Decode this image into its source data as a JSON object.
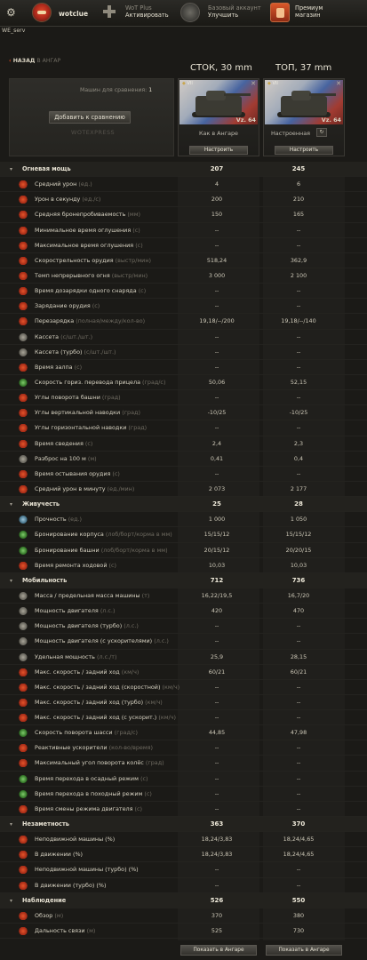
{
  "topbar": {
    "nickname": "wotclue",
    "wotplus": {
      "line1": "WoT Plus",
      "line2": "Активировать"
    },
    "account": {
      "line1": "Базовый аккаунт",
      "line2": "Улучшить"
    },
    "premium": {
      "line1": "Премиум",
      "line2": "магазин"
    },
    "server": "WE_serv"
  },
  "nav": {
    "back_label": "НАЗАД",
    "back_context": "В АНГАР"
  },
  "columns": {
    "col1_title": "СТОК, 30 mm",
    "col2_title": "ТОП, 37 mm"
  },
  "compare": {
    "count_label": "Машин для сравнения:",
    "count_value": "1",
    "add_button": "Добавить к сравнению",
    "watermark": "WOTEXPRESS"
  },
  "tanks": [
    {
      "tier": "VII",
      "name": "Vz. 64",
      "state": "Как в Ангаре",
      "configure": "Настроить",
      "flag_colors": [
        "#efe8e2",
        "#4d6fb6",
        "#b84035"
      ]
    },
    {
      "tier": "VII",
      "name": "Vz. 64",
      "state": "Настроенная",
      "configure": "Настроить",
      "flag_colors": [
        "#efe8e2",
        "#4d6fb6",
        "#b84035"
      ]
    }
  ],
  "rows": [
    {
      "type": "section",
      "name": "Огневая мощь",
      "unit": "",
      "v1": "207",
      "v2": "245"
    },
    {
      "type": "row",
      "icon": "red",
      "name": "Средний урон",
      "unit": "(ед.)",
      "v1": "4",
      "v2": "6"
    },
    {
      "type": "row",
      "icon": "red",
      "name": "Урон в секунду",
      "unit": "(ед./с)",
      "v1": "200",
      "v2": "210"
    },
    {
      "type": "row",
      "icon": "red",
      "name": "Средняя бронепробиваемость",
      "unit": "(мм)",
      "v1": "150",
      "v2": "165"
    },
    {
      "type": "row",
      "icon": "red",
      "name": "Минимальное время оглушения",
      "unit": "(с)",
      "v1": "--",
      "v2": "--"
    },
    {
      "type": "row",
      "icon": "red",
      "name": "Максимальное время оглушения",
      "unit": "(с)",
      "v1": "--",
      "v2": "--"
    },
    {
      "type": "row",
      "icon": "red",
      "name": "Скорострельность орудия",
      "unit": "(выстр/мин)",
      "v1": "518,24",
      "v2": "362,9"
    },
    {
      "type": "row",
      "icon": "red",
      "name": "Темп непрерывного огня",
      "unit": "(выстр/мин)",
      "v1": "3 000",
      "v2": "2 100"
    },
    {
      "type": "row",
      "icon": "red",
      "name": "Время дозарядки одного снаряда",
      "unit": "(с)",
      "v1": "--",
      "v2": "--"
    },
    {
      "type": "row",
      "icon": "red",
      "name": "Зарядание орудия",
      "unit": "(с)",
      "v1": "--",
      "v2": "--"
    },
    {
      "type": "row",
      "icon": "red",
      "name": "Перезарядка",
      "unit": "(полная/между/кол-во)",
      "v1": "19,18/--/200",
      "v2": "19,18/--/140"
    },
    {
      "type": "row",
      "icon": "grey",
      "name": "Кассета",
      "unit": "(с/шт./шт.)",
      "v1": "--",
      "v2": "--"
    },
    {
      "type": "row",
      "icon": "grey",
      "name": "Кассета (турбо)",
      "unit": "(с/шт./шт.)",
      "v1": "--",
      "v2": "--"
    },
    {
      "type": "row",
      "icon": "red",
      "name": "Время залпа",
      "unit": "(с)",
      "v1": "--",
      "v2": "--"
    },
    {
      "type": "row",
      "icon": "green",
      "name": "Скорость гориз. перевода прицела",
      "unit": "(град/с)",
      "v1": "50,06",
      "v2": "52,15"
    },
    {
      "type": "row",
      "icon": "red",
      "name": "Углы поворота башни",
      "unit": "(град)",
      "v1": "--",
      "v2": "--"
    },
    {
      "type": "row",
      "icon": "red",
      "name": "Углы вертикальной наводки",
      "unit": "(град)",
      "v1": "-10/25",
      "v2": "-10/25"
    },
    {
      "type": "row",
      "icon": "red",
      "name": "Углы горизонтальной наводки",
      "unit": "(град)",
      "v1": "--",
      "v2": "--"
    },
    {
      "type": "row",
      "icon": "red",
      "name": "Время сведения",
      "unit": "(с)",
      "v1": "2,4",
      "v2": "2,3"
    },
    {
      "type": "row",
      "icon": "grey",
      "name": "Разброс на 100 м",
      "unit": "(м)",
      "v1": "0,41",
      "v2": "0,4"
    },
    {
      "type": "row",
      "icon": "red",
      "name": "Время остывания орудия",
      "unit": "(с)",
      "v1": "--",
      "v2": "--"
    },
    {
      "type": "row",
      "icon": "red",
      "name": "Средний урон в минуту",
      "unit": "(ед./мин)",
      "v1": "2 073",
      "v2": "2 177"
    },
    {
      "type": "section",
      "name": "Живучесть",
      "unit": "",
      "v1": "25",
      "v2": "28"
    },
    {
      "type": "row",
      "icon": "blue",
      "name": "Прочность",
      "unit": "(ед.)",
      "v1": "1 000",
      "v2": "1 050"
    },
    {
      "type": "row",
      "icon": "green",
      "name": "Бронирование корпуса",
      "unit": "(лоб/борт/корма в мм)",
      "v1": "15/15/12",
      "v2": "15/15/12"
    },
    {
      "type": "row",
      "icon": "green",
      "name": "Бронирование башни",
      "unit": "(лоб/борт/корма в мм)",
      "v1": "20/15/12",
      "v2": "20/20/15"
    },
    {
      "type": "row",
      "icon": "red",
      "name": "Время ремонта ходовой",
      "unit": "(с)",
      "v1": "10,03",
      "v2": "10,03"
    },
    {
      "type": "section",
      "name": "Мобильность",
      "unit": "",
      "v1": "712",
      "v2": "736"
    },
    {
      "type": "row",
      "icon": "grey",
      "name": "Масса / предельная масса машины",
      "unit": "(т)",
      "v1": "16,22/19,5",
      "v2": "16,7/20"
    },
    {
      "type": "row",
      "icon": "grey",
      "name": "Мощность двигателя",
      "unit": "(л.с.)",
      "v1": "420",
      "v2": "470"
    },
    {
      "type": "row",
      "icon": "grey",
      "name": "Мощность двигателя (турбо)",
      "unit": "(л.с.)",
      "v1": "--",
      "v2": "--"
    },
    {
      "type": "row",
      "icon": "grey",
      "name": "Мощность двигателя (с ускорителями)",
      "unit": "(л.с.)",
      "v1": "--",
      "v2": "--"
    },
    {
      "type": "row",
      "icon": "grey",
      "name": "Удельная мощность",
      "unit": "(л.с./т)",
      "v1": "25,9",
      "v2": "28,15"
    },
    {
      "type": "row",
      "icon": "red",
      "name": "Макс. скорость / задний ход",
      "unit": "(км/ч)",
      "v1": "60/21",
      "v2": "60/21"
    },
    {
      "type": "row",
      "icon": "red",
      "name": "Макс. скорость / задний ход (скоростной)",
      "unit": "(км/ч)",
      "v1": "--",
      "v2": "--"
    },
    {
      "type": "row",
      "icon": "red",
      "name": "Макс. скорость / задний ход (турбо)",
      "unit": "(км/ч)",
      "v1": "--",
      "v2": "--"
    },
    {
      "type": "row",
      "icon": "red",
      "name": "Макс. скорость / задний ход (с ускорит.)",
      "unit": "(км/ч)",
      "v1": "--",
      "v2": "--"
    },
    {
      "type": "row",
      "icon": "green",
      "name": "Скорость поворота шасси",
      "unit": "(град/с)",
      "v1": "44,85",
      "v2": "47,98"
    },
    {
      "type": "row",
      "icon": "red",
      "name": "Реактивные ускорители",
      "unit": "(кол-во/время)",
      "v1": "--",
      "v2": "--"
    },
    {
      "type": "row",
      "icon": "red",
      "name": "Максимальный угол поворота колёс",
      "unit": "(град)",
      "v1": "--",
      "v2": "--"
    },
    {
      "type": "row",
      "icon": "green",
      "name": "Время перехода в осадный режим",
      "unit": "(с)",
      "v1": "--",
      "v2": "--"
    },
    {
      "type": "row",
      "icon": "green",
      "name": "Время перехода в походный режим",
      "unit": "(с)",
      "v1": "--",
      "v2": "--"
    },
    {
      "type": "row",
      "icon": "red",
      "name": "Время смены режима двигателя",
      "unit": "(с)",
      "v1": "--",
      "v2": "--"
    },
    {
      "type": "section",
      "name": "Незаметность",
      "unit": "",
      "v1": "363",
      "v2": "370"
    },
    {
      "type": "row",
      "icon": "red",
      "name": "Неподвижной машины (%)",
      "unit": "",
      "v1": "18,24/3,83",
      "v2": "18,24/4,65"
    },
    {
      "type": "row",
      "icon": "red",
      "name": "В движении (%)",
      "unit": "",
      "v1": "18,24/3,83",
      "v2": "18,24/4,65"
    },
    {
      "type": "row",
      "icon": "red",
      "name": "Неподвижной машины (турбо) (%)",
      "unit": "",
      "v1": "--",
      "v2": "--"
    },
    {
      "type": "row",
      "icon": "red",
      "name": "В движении (турбо) (%)",
      "unit": "",
      "v1": "--",
      "v2": "--"
    },
    {
      "type": "section",
      "name": "Наблюдение",
      "unit": "",
      "v1": "526",
      "v2": "550"
    },
    {
      "type": "row",
      "icon": "red",
      "name": "Обзор",
      "unit": "(м)",
      "v1": "370",
      "v2": "380"
    },
    {
      "type": "row",
      "icon": "red",
      "name": "Дальность связи",
      "unit": "(м)",
      "v1": "525",
      "v2": "730"
    }
  ],
  "footer": {
    "show_in_hangar": "Показать в Ангаре"
  }
}
